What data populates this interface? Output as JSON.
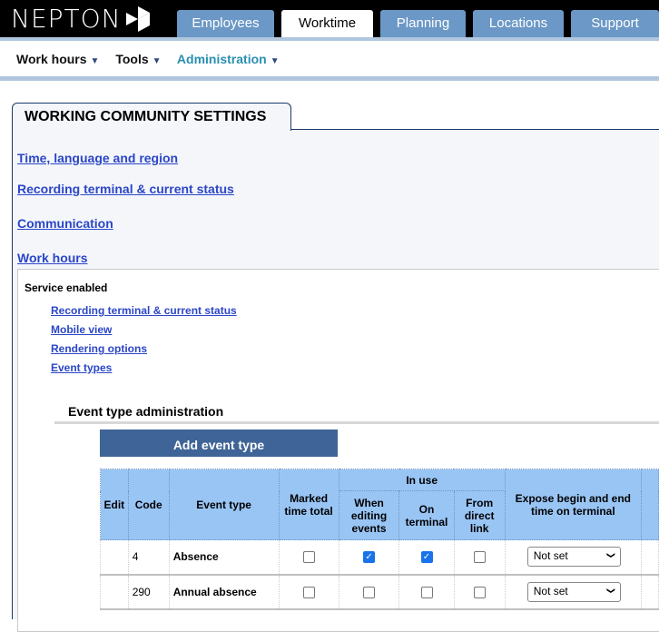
{
  "brand": "NEPTON",
  "tabs": [
    "Employees",
    "Worktime",
    "Planning",
    "Locations",
    "Support"
  ],
  "subnav": [
    "Work hours",
    "Tools",
    "Administration"
  ],
  "page_title": "WORKING COMMUNITY SETTINGS",
  "links": [
    "Time, language and region",
    "Recording terminal & current status",
    "Communication",
    "Work hours"
  ],
  "service_status": "Service enabled",
  "sub_links": [
    "Recording terminal & current status",
    "Mobile view",
    "Rendering options",
    "Event types"
  ],
  "section_title": "Event type administration",
  "add_button": "Add event type",
  "table": {
    "headers": {
      "edit": "Edit",
      "code": "Code",
      "event_type": "Event type",
      "marked": "Marked time total",
      "in_use": "In use",
      "when_editing": "When editing events",
      "on_terminal": "On terminal",
      "from_link": "From direct link",
      "expose": "Expose begin and end time on terminal"
    },
    "rows": [
      {
        "code": "4",
        "event_type": "Absence",
        "marked": false,
        "when_editing": true,
        "on_terminal": true,
        "from_link": false,
        "expose": "Not set"
      },
      {
        "code": "290",
        "event_type": "Annual absence",
        "marked": false,
        "when_editing": false,
        "on_terminal": false,
        "from_link": false,
        "expose": "Not set"
      }
    ]
  },
  "colors": {
    "tab": "#6b98c6",
    "header": "#99c5f5",
    "button": "#3f6497",
    "link": "#2b46c7",
    "active_subnav": "#2a8fb0"
  }
}
